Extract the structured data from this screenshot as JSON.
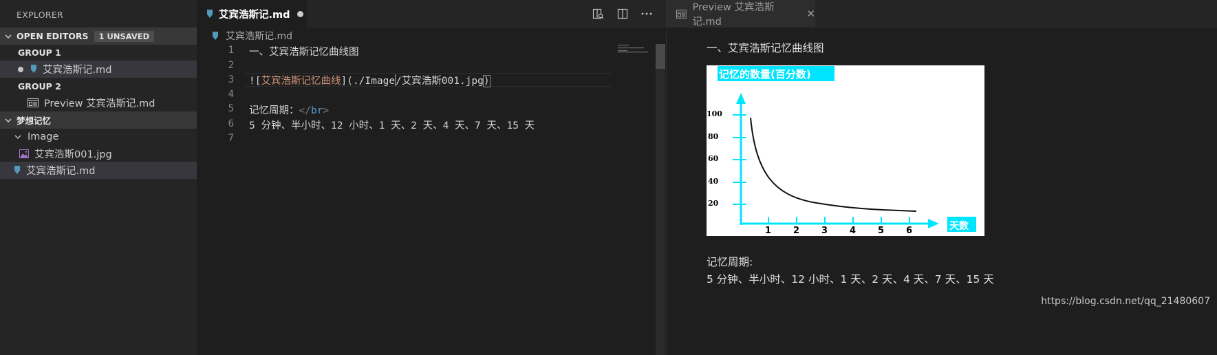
{
  "explorer": {
    "title": "EXPLORER",
    "open_editors": {
      "label": "OPEN EDITORS",
      "badge": "1 UNSAVED",
      "group1_label": "GROUP 1",
      "group1_file": "艾宾浩斯记.md",
      "group2_label": "GROUP 2",
      "group2_file": "Preview 艾宾浩斯记.md"
    },
    "workspace": {
      "label": "梦想记忆",
      "folder": "Image",
      "image_file": "艾宾浩斯001.jpg",
      "md_file": "艾宾浩斯记.md"
    }
  },
  "editor": {
    "tab_label": "艾宾浩斯记.md",
    "breadcrumb": "艾宾浩斯记.md",
    "line_numbers": [
      "1",
      "2",
      "3",
      "4",
      "5",
      "6",
      "7"
    ],
    "lines": {
      "l1": "一、艾宾浩斯记忆曲线图",
      "l3_prefix": "![",
      "l3_alt": "艾宾浩斯记忆曲线",
      "l3_mid": "](",
      "l3_path_a": "./Image",
      "l3_path_b": "/艾宾浩斯001.jpg",
      "l3_end": ")",
      "l5_text": "记忆周期：",
      "l5_tag_open": "</",
      "l5_tag_name": "br",
      "l5_tag_close": ">",
      "l6": "5 分钟、半小时、12 小时、1 天、2 天、4 天、7 天、15 天"
    }
  },
  "preview": {
    "tab_label": "Preview 艾宾浩斯记.md",
    "heading": "一、艾宾浩斯记忆曲线图",
    "image": {
      "y_title": "记忆的数量(百分数)",
      "x_title": "天数",
      "y_ticks": [
        "100",
        "80",
        "60",
        "40",
        "20"
      ],
      "x_ticks": [
        "1",
        "2",
        "3",
        "4",
        "5",
        "6"
      ]
    },
    "period_label": "记忆周期:",
    "period_text": "5 分钟、半小时、12 小时、1 天、2 天、4 天、7 天、15 天"
  },
  "watermark": "https://blog.csdn.net/qq_21480607",
  "colors": {
    "accent_md_icon": "#519aba",
    "image_icon": "#a074c4",
    "chart_axis": "#00e5ff"
  }
}
